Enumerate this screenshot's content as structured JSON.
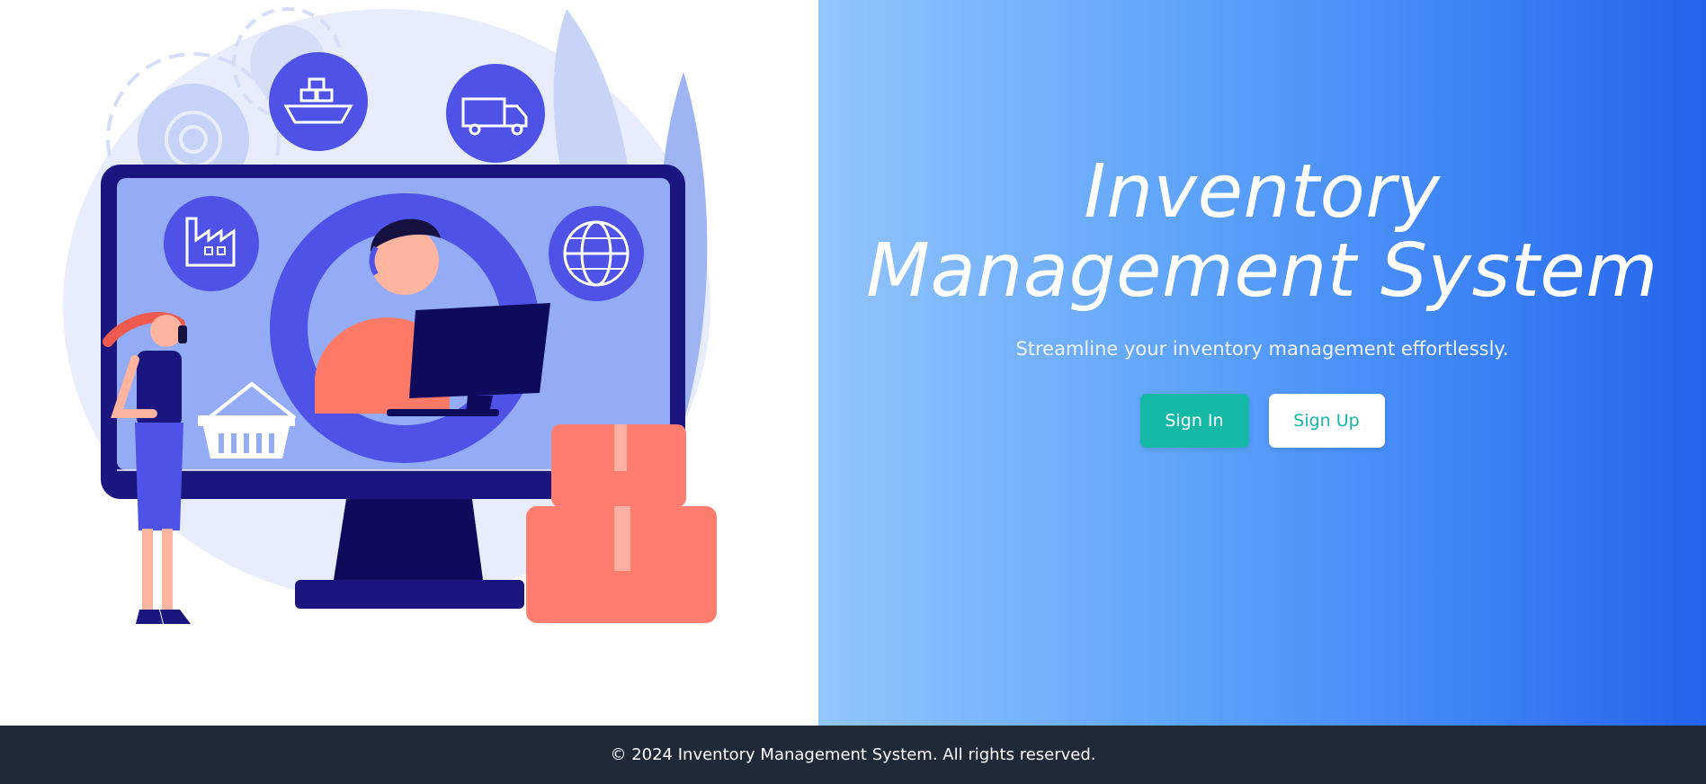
{
  "hero": {
    "title": "Inventory Management System",
    "subtitle": "Streamline your inventory management effortlessly."
  },
  "actions": {
    "sign_in_label": "Sign In",
    "sign_up_label": "Sign Up"
  },
  "footer": {
    "copyright": "© 2024 Inventory Management System. All rights reserved."
  },
  "colors": {
    "gradient_start": "#93c5fd",
    "gradient_end": "#2563eb",
    "primary_button": "#14b8a6",
    "footer_bg": "#1f2937"
  },
  "illustration": {
    "icons": [
      "gear-icon",
      "ship-icon",
      "truck-icon",
      "factory-icon",
      "globe-icon",
      "basket-icon",
      "box-icon",
      "headset-icon",
      "monitor-icon"
    ]
  }
}
